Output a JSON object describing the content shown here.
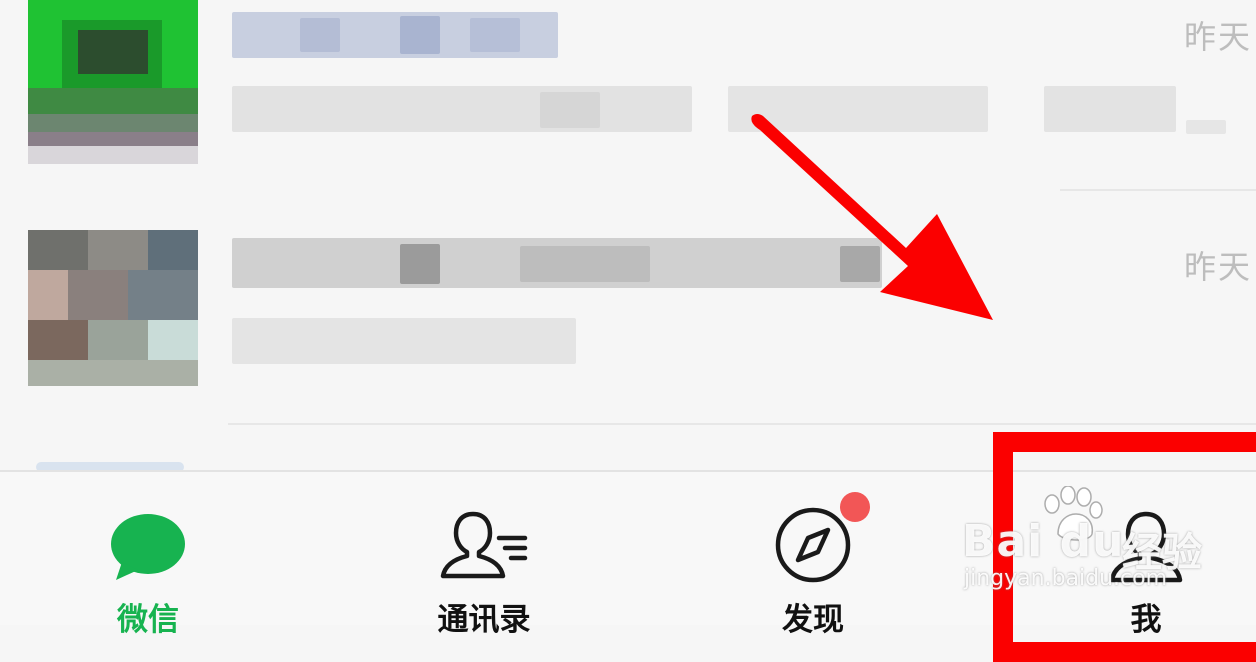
{
  "chats": [
    {
      "time": "昨天"
    },
    {
      "time": "昨天"
    }
  ],
  "tabs": [
    {
      "label": "微信",
      "icon": "chat-bubble-icon",
      "active": true
    },
    {
      "label": "通讯录",
      "icon": "contacts-icon",
      "active": false
    },
    {
      "label": "发现",
      "icon": "compass-icon",
      "active": false,
      "badge": true
    },
    {
      "label": "我",
      "icon": "person-icon",
      "active": false
    }
  ],
  "watermark": {
    "brand": "Bai du",
    "cn": "经验",
    "url": "jingyan.baidu.com"
  },
  "colors": {
    "accent": "#17b350",
    "badge": "#f25656",
    "annotation": "#fb0000"
  }
}
